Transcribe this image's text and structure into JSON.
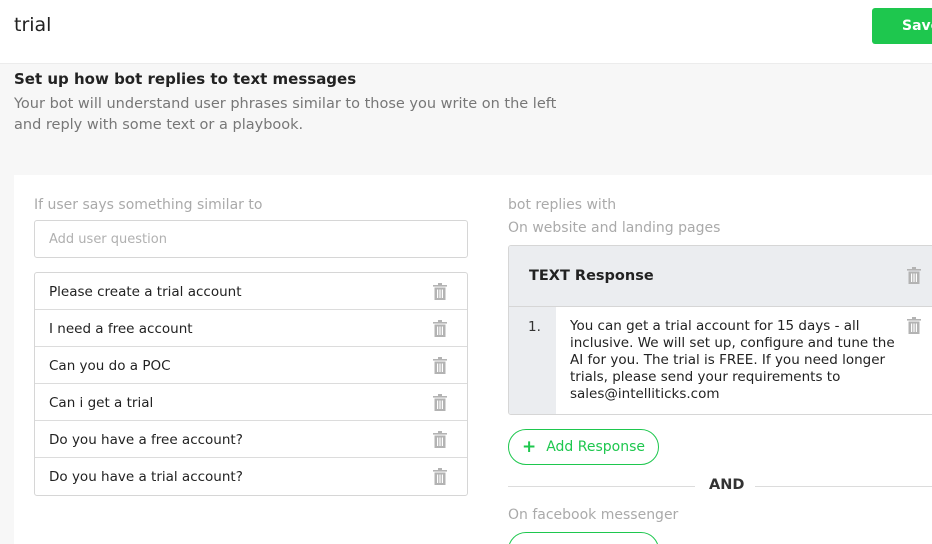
{
  "header": {
    "bot_name": "trial",
    "save_label": "Save"
  },
  "section": {
    "title": "Set up how bot replies to text messages",
    "description": "Your bot will understand user phrases similar to those you write on the left and reply with some text or a playbook."
  },
  "left": {
    "label": "If user says something similar to",
    "input_placeholder": "Add user question",
    "phrases": [
      "Please create a trial account",
      "I need a free account",
      "Can you do a POC",
      "Can i get a trial",
      "Do you have a free account?",
      "Do you have a trial account?"
    ]
  },
  "right": {
    "label": "bot replies with",
    "channel_website": "On website and landing pages",
    "response_title": "TEXT Response",
    "responses": [
      {
        "number": "1.",
        "text": "You can get a trial account for 15 days - all inclusive. We will set up, configure and tune the AI for you. The trial is FREE. If you need longer trials, please send your requirements to sales@intelliticks.com"
      }
    ],
    "add_response_label": "Add Response",
    "add_response_icon": "plus-icon",
    "separator": "AND",
    "channel_facebook": "On facebook messenger"
  },
  "icons": {
    "delete": "trash-icon"
  },
  "colors": {
    "accent": "#1ec74e",
    "muted_text": "#aaaaaa",
    "card_header": "#ebedf0"
  }
}
